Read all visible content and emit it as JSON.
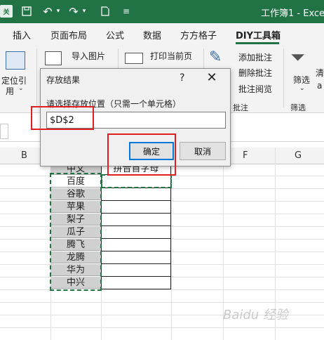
{
  "titlebar": {
    "brand": "关",
    "window_title": "工作簿1 - Excel"
  },
  "tabs": [
    {
      "label": "插入"
    },
    {
      "label": "页面布局"
    },
    {
      "label": "公式"
    },
    {
      "label": "数据"
    },
    {
      "label": "方方格子"
    },
    {
      "label": "DIY工具箱"
    }
  ],
  "ribbon": {
    "locate_ref_line1": "定位引",
    "locate_ref_line2": "用",
    "import_images": "导入图片",
    "print_current_page": "打印当前页",
    "add_comment": "添加批注",
    "delete_comment": "删除批注",
    "comment_view": "批注阅览",
    "comment_group": "批注",
    "filter": "筛选",
    "filter_group": "筛选",
    "clear_partial": "清",
    "partial_letter": "a"
  },
  "columns": [
    "B",
    "F",
    "G"
  ],
  "cells": {
    "header_b": "中文",
    "header_c": "拼音首字母",
    "items": [
      "百度",
      "谷歌",
      "苹果",
      "梨子",
      "瓜子",
      "腾飞",
      "龙腾",
      "华为",
      "中兴"
    ]
  },
  "dialog": {
    "title": "存放结果",
    "help": "?",
    "close": "✕",
    "prompt": "请选择存放位置（只需一个单元格）",
    "value": "$D$2",
    "ok": "确定",
    "cancel": "取消"
  },
  "watermark": "Baidu 经验"
}
